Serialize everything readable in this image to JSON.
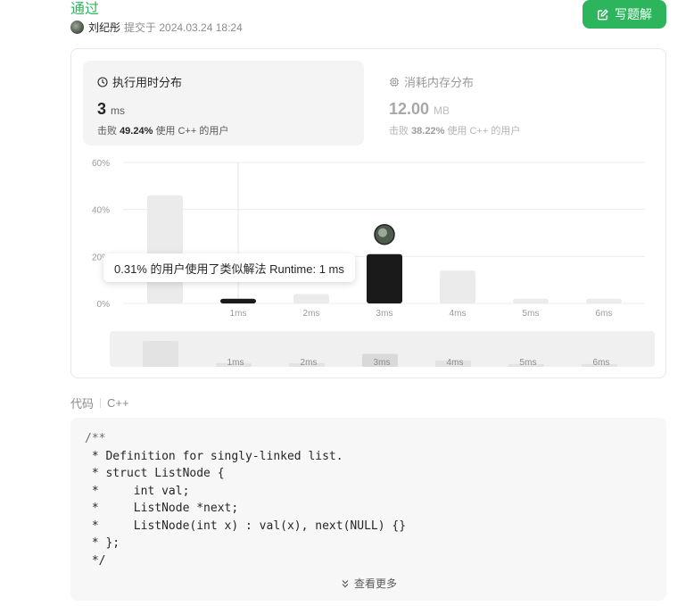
{
  "submission": {
    "status": "通过",
    "author": "刘纪彤",
    "submitted_at": "提交于 2024.03.24 18:24",
    "solve_button": "写题解"
  },
  "runtime": {
    "title": "执行用时分布",
    "value": "3",
    "unit": "ms",
    "beats_prefix": "击败",
    "beats_pct": "49.24%",
    "beats_suffix": "使用 C++ 的用户"
  },
  "memory": {
    "title": "消耗内存分布",
    "value": "12.00",
    "unit": "MB",
    "beats_prefix": "击败",
    "beats_pct": "38.22%",
    "beats_suffix": "使用 C++ 的用户"
  },
  "tooltip": "0.31% 的用户使用了类似解法 Runtime: 1 ms",
  "chart_data": {
    "type": "bar",
    "y_ticks": [
      "60%",
      "40%",
      "20%",
      "0%"
    ],
    "ylim": [
      0,
      60
    ],
    "categories": [
      "",
      "1ms",
      "2ms",
      "3ms",
      "4ms",
      "5ms",
      "6ms"
    ],
    "values": [
      46,
      2,
      4,
      21,
      14,
      2,
      2
    ],
    "highlighted_category": "3ms",
    "hovered_category": "1ms",
    "grid": true,
    "colors": {
      "bar": "#ebebeb",
      "highlight": "#1a1a1a",
      "grid": "#ececec",
      "brush_bg": "#f0f0f0"
    },
    "overview_values": [
      28,
      4,
      4,
      14,
      7,
      3,
      3
    ]
  },
  "code": {
    "label": "代码",
    "language": "C++",
    "lines": [
      "/**",
      " * Definition for singly-linked list.",
      " * struct ListNode {",
      " *     int val;",
      " *     ListNode *next;",
      " *     ListNode(int x) : val(x), next(NULL) {}",
      " * };",
      " */"
    ],
    "show_more": "查看更多"
  },
  "icons": {
    "edit": "edit-icon",
    "clock": "clock-icon",
    "chip": "chip-icon",
    "chevron": "chevron-double-down-icon"
  }
}
